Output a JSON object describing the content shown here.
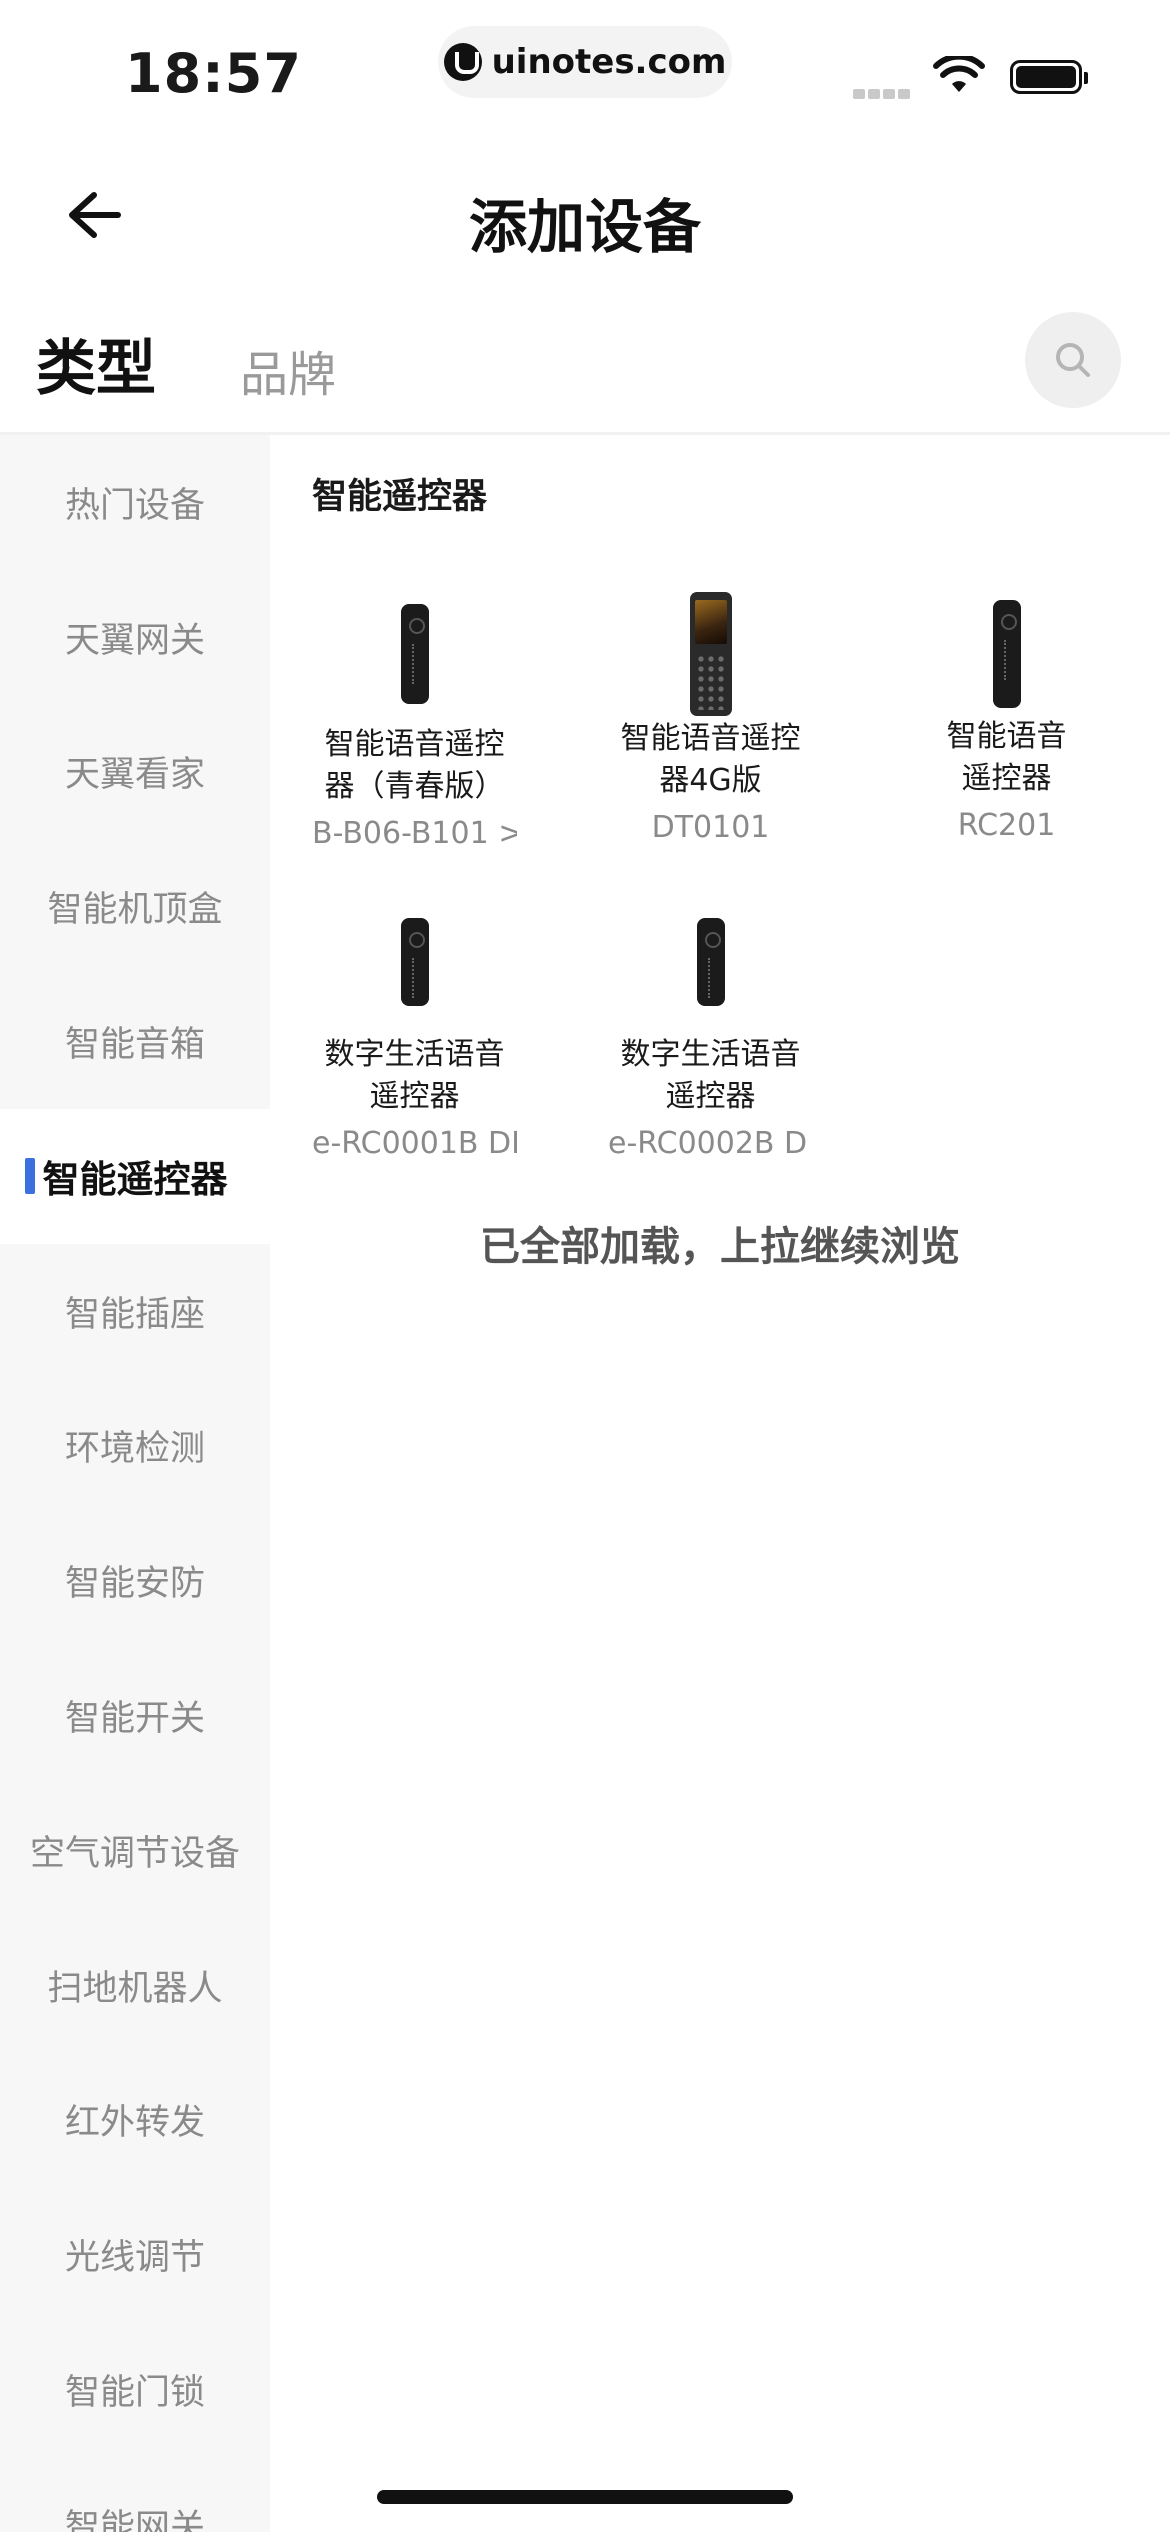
{
  "status_bar": {
    "time": "18:57",
    "url": "uinotes.com"
  },
  "header": {
    "title": "添加设备"
  },
  "tabs": {
    "type": "类型",
    "brand": "品牌"
  },
  "sidebar": {
    "active_index": 5,
    "items": [
      "热门设备",
      "天翼网关",
      "天翼看家",
      "智能机顶盒",
      "智能音箱",
      "智能遥控器",
      "智能插座",
      "环境检测",
      "智能安防",
      "智能开关",
      "空气调节设备",
      "扫地机器人",
      "红外转发",
      "光线调节",
      "智能门锁",
      "智能网关"
    ]
  },
  "content": {
    "section_title": "智能遥控器",
    "products": [
      {
        "name": "智能语音遥控器（青春版）",
        "model": "B-B06-B101 >",
        "image": "remote"
      },
      {
        "name": "智能语音遥控器4G版",
        "model": "DT0101",
        "image": "phone-remote"
      },
      {
        "name": "智能语音遥控器",
        "model": "RC201",
        "image": "remote"
      },
      {
        "name": "数字生活语音遥控器",
        "model": "e-RC0001B DI",
        "image": "remote"
      },
      {
        "name": "数字生活语音遥控器",
        "model": "e-RC0002B D",
        "image": "remote"
      }
    ],
    "loaded_tip": "已全部加载，上拉继续浏览"
  },
  "icons": {
    "back": "arrow-left-icon",
    "search": "search-icon",
    "wifi": "wifi-icon",
    "battery": "battery-icon"
  },
  "colors": {
    "accent": "#3c6fe0",
    "sidebar_bg": "#f7f7f7"
  }
}
